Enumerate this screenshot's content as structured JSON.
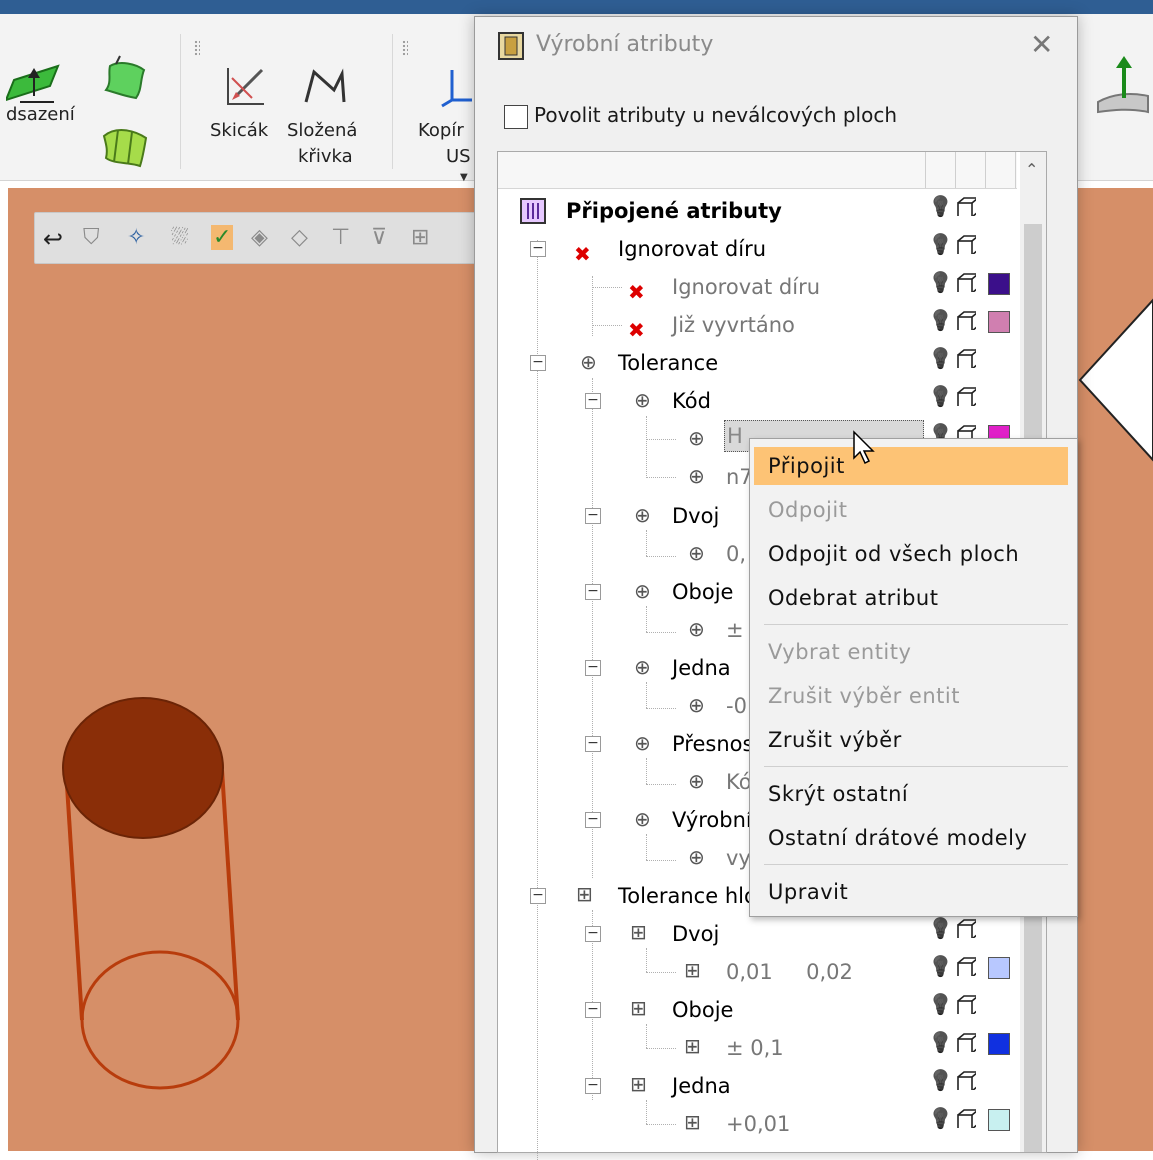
{
  "ribbon": {
    "labels": {
      "odsazeni": "dsazení",
      "skicak": "Skicák",
      "slozena1": "Složená",
      "slozena2": "křivka",
      "kopir1": "Kopír",
      "kopir2": "US"
    }
  },
  "dialog": {
    "title": "Výrobní atributy",
    "checkbox_label": "Povolit atributy u neválcových ploch",
    "checkbox_checked": false
  },
  "tree": {
    "rows": [
      {
        "label": "Připojené atributy"
      },
      {
        "label": "Ignorovat díru"
      },
      {
        "label": "Ignorovat díru"
      },
      {
        "label": "Již vyvrtáno"
      },
      {
        "label": "Tolerance"
      },
      {
        "label": "Kód"
      },
      {
        "label": "H"
      },
      {
        "label": "n7"
      },
      {
        "label": "Dvoj"
      },
      {
        "label": "0,"
      },
      {
        "label": "Oboje"
      },
      {
        "label": "±"
      },
      {
        "label": "Jedna"
      },
      {
        "label": "-0"
      },
      {
        "label": "Přesnos"
      },
      {
        "label": "Kó"
      },
      {
        "label": "Výrobní"
      },
      {
        "label": "vy"
      },
      {
        "label": "Tolerance hlo"
      },
      {
        "label": "Dvoj"
      },
      {
        "label": "0,01     0,02"
      },
      {
        "label": "Oboje"
      },
      {
        "label": "± 0,1"
      },
      {
        "label": "Jedna"
      },
      {
        "label": "+0,01"
      }
    ],
    "swatches": {
      "ignorovat_diru": "#3b0f8a",
      "jiz_vyvrtano": "#d07fb0",
      "kod_h": "#e020c8",
      "dvoj_hlo": "#b8c8ff",
      "oboje_hlo": "#1030e0",
      "jedna_hlo": "#c8f0f0"
    }
  },
  "context_menu": {
    "items": [
      {
        "label": "Připojit",
        "enabled": true,
        "highlighted": true
      },
      {
        "label": "Odpojit",
        "enabled": false
      },
      {
        "label": "Odpojit od všech ploch",
        "enabled": true
      },
      {
        "label": "Odebrat atribut",
        "enabled": true
      },
      {
        "label": "Vybrat entity",
        "enabled": false
      },
      {
        "label": "Zrušit výběr entit",
        "enabled": false
      },
      {
        "label": "Zrušit výběr",
        "enabled": true
      },
      {
        "label": "Skrýt ostatní",
        "enabled": true
      },
      {
        "label": "Ostatní drátové modely",
        "enabled": true
      },
      {
        "label": "Upravit",
        "enabled": true
      }
    ]
  },
  "colors": {
    "viewport": "#d68f68",
    "cylinder_fill": "#8a2e08",
    "cylinder_stroke": "#b83c0c",
    "menu_highlight": "#fdc375"
  }
}
